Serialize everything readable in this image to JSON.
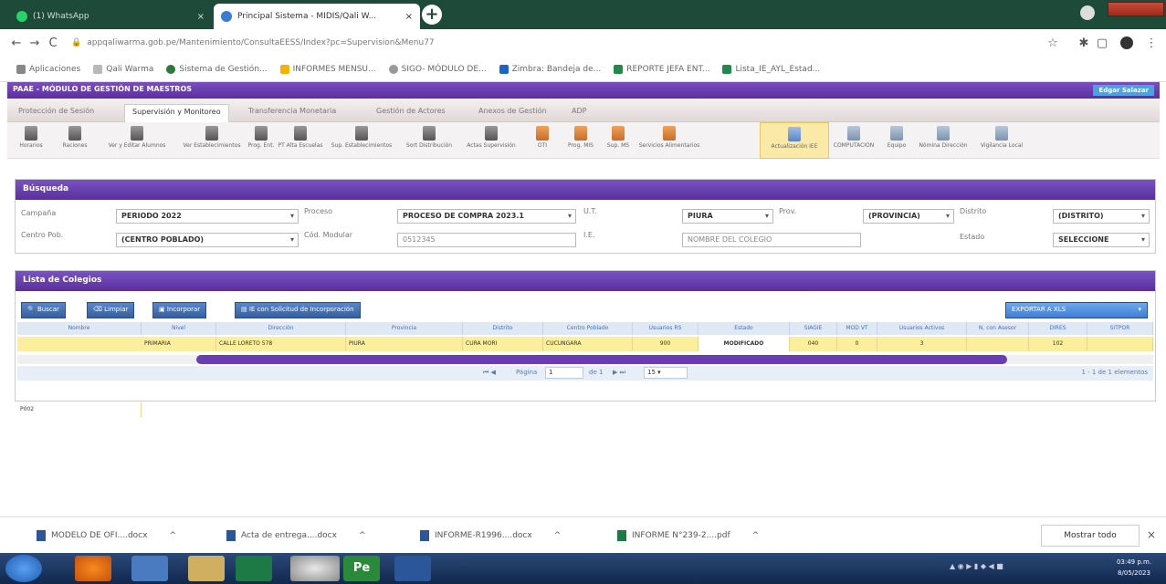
{
  "browser": {
    "tabs": [
      {
        "label": "(1) WhatsApp"
      },
      {
        "label": "Principal Sistema - MIDIS/Qali W..."
      }
    ],
    "url": "appqaliwarma.gob.pe/Mantenimiento/ConsultaEESS/Index?pc=Supervision&Menu77",
    "bookmarks": [
      {
        "label": "Aplicaciones"
      },
      {
        "label": "Qali Warma"
      },
      {
        "label": "Sistema de Gestión..."
      },
      {
        "label": "INFORMES MENSU..."
      },
      {
        "label": "SIGO- MÓDULO DE..."
      },
      {
        "label": "Zimbra: Bandeja de..."
      },
      {
        "label": "REPORTE JEFA ENT..."
      },
      {
        "label": "Lista_IE_AYL_Estad..."
      }
    ]
  },
  "app": {
    "title": "PAAE - MÓDULO DE GESTIÓN DE MAESTROS",
    "user": "Edgar Salazar"
  },
  "menu_tabs": [
    {
      "label": "Protección de Sesión"
    },
    {
      "label": "Supervisión y Monitoreo"
    },
    {
      "label": "Transferencia Monetaria"
    },
    {
      "label": "Gestión de Actores"
    },
    {
      "label": "Anexos de Gestión"
    },
    {
      "label": "ADP"
    }
  ],
  "toolbar": [
    {
      "label": "Horarios"
    },
    {
      "label": "Raciones"
    },
    {
      "label": "Ver y Editar Alumnos"
    },
    {
      "label": "Ver Establecimientos"
    },
    {
      "label": "Prog. Ent."
    },
    {
      "label": "PT Alta Escuelas"
    },
    {
      "label": "Sup. Establecimientos"
    },
    {
      "label": "Sort Distribución"
    },
    {
      "label": "Actas Supervisión"
    },
    {
      "label": "OTI"
    },
    {
      "label": "Prog. MIS"
    },
    {
      "label": "Sup. MS"
    },
    {
      "label": "Servicios Alimentarios"
    },
    {
      "label": "Actualización IEE"
    },
    {
      "label": "COMPUTACION"
    },
    {
      "label": "Equipo"
    },
    {
      "label": "Nómina Dirección"
    },
    {
      "label": "Vigilancia Local"
    }
  ],
  "search": {
    "title": "Búsqueda",
    "campana_label": "Campaña",
    "campana_value": "PERIODO 2022",
    "proceso_label": "Proceso",
    "proceso_value": "PROCESO DE COMPRA 2023.1",
    "ut_label": "U.T.",
    "ut_value": "PIURA",
    "prov_label": "Prov.",
    "prov_value": "(PROVINCIA)",
    "distrito_label": "Distrito",
    "distrito_value": "(DISTRITO)",
    "centro_label": "Centro Pob.",
    "centro_value": "(CENTRO POBLADO)",
    "cod_label": "Cód. Modular",
    "cod_value": "0512345",
    "ie_label": "I.E.",
    "ie_placeholder": "NOMBRE DEL COLEGIO",
    "estado_label": "Estado",
    "estado_value": "SELECCIONE"
  },
  "list": {
    "title": "Lista de Colegios",
    "buttons": [
      {
        "label": "Buscar"
      },
      {
        "label": "Limpiar"
      },
      {
        "label": "Incorporar"
      },
      {
        "label": "IE con Solicitud de Incorporación"
      }
    ],
    "export_label": "EXPORTAR A XLS",
    "columns": [
      "Nombre",
      "Nivel",
      "Dirección",
      "Provincia",
      "Distrito",
      "Centro Poblado",
      "Usuarios RS",
      "Estado",
      "SIAGIE",
      "MOD VT",
      "Usuarios Activos",
      "N. con Asesor",
      "DIRES",
      "SITPOR"
    ],
    "rows": [
      [
        "P002",
        "PRIMARIA",
        "CALLE LORETO 578",
        "PIURA",
        "CURA MORI",
        "CUCUNGARA",
        "900",
        "MODIFICADO",
        "040",
        "0",
        "3",
        "",
        "102",
        ""
      ]
    ],
    "pager": {
      "page_label": "Página",
      "page_value": "1",
      "of_label": "de 1",
      "size_value": "15",
      "summary": "1 - 1 de 1 elementos"
    }
  },
  "downloads": {
    "items": [
      {
        "label": "MODELO DE OFI....docx"
      },
      {
        "label": "Acta de entrega....docx"
      },
      {
        "label": "INFORME-R1996....docx"
      },
      {
        "label": "INFORME N°239-2....pdf"
      }
    ],
    "show_all": "Mostrar todo"
  },
  "taskbar": {
    "time": "03:49 p.m.",
    "date": "8/05/2023"
  }
}
